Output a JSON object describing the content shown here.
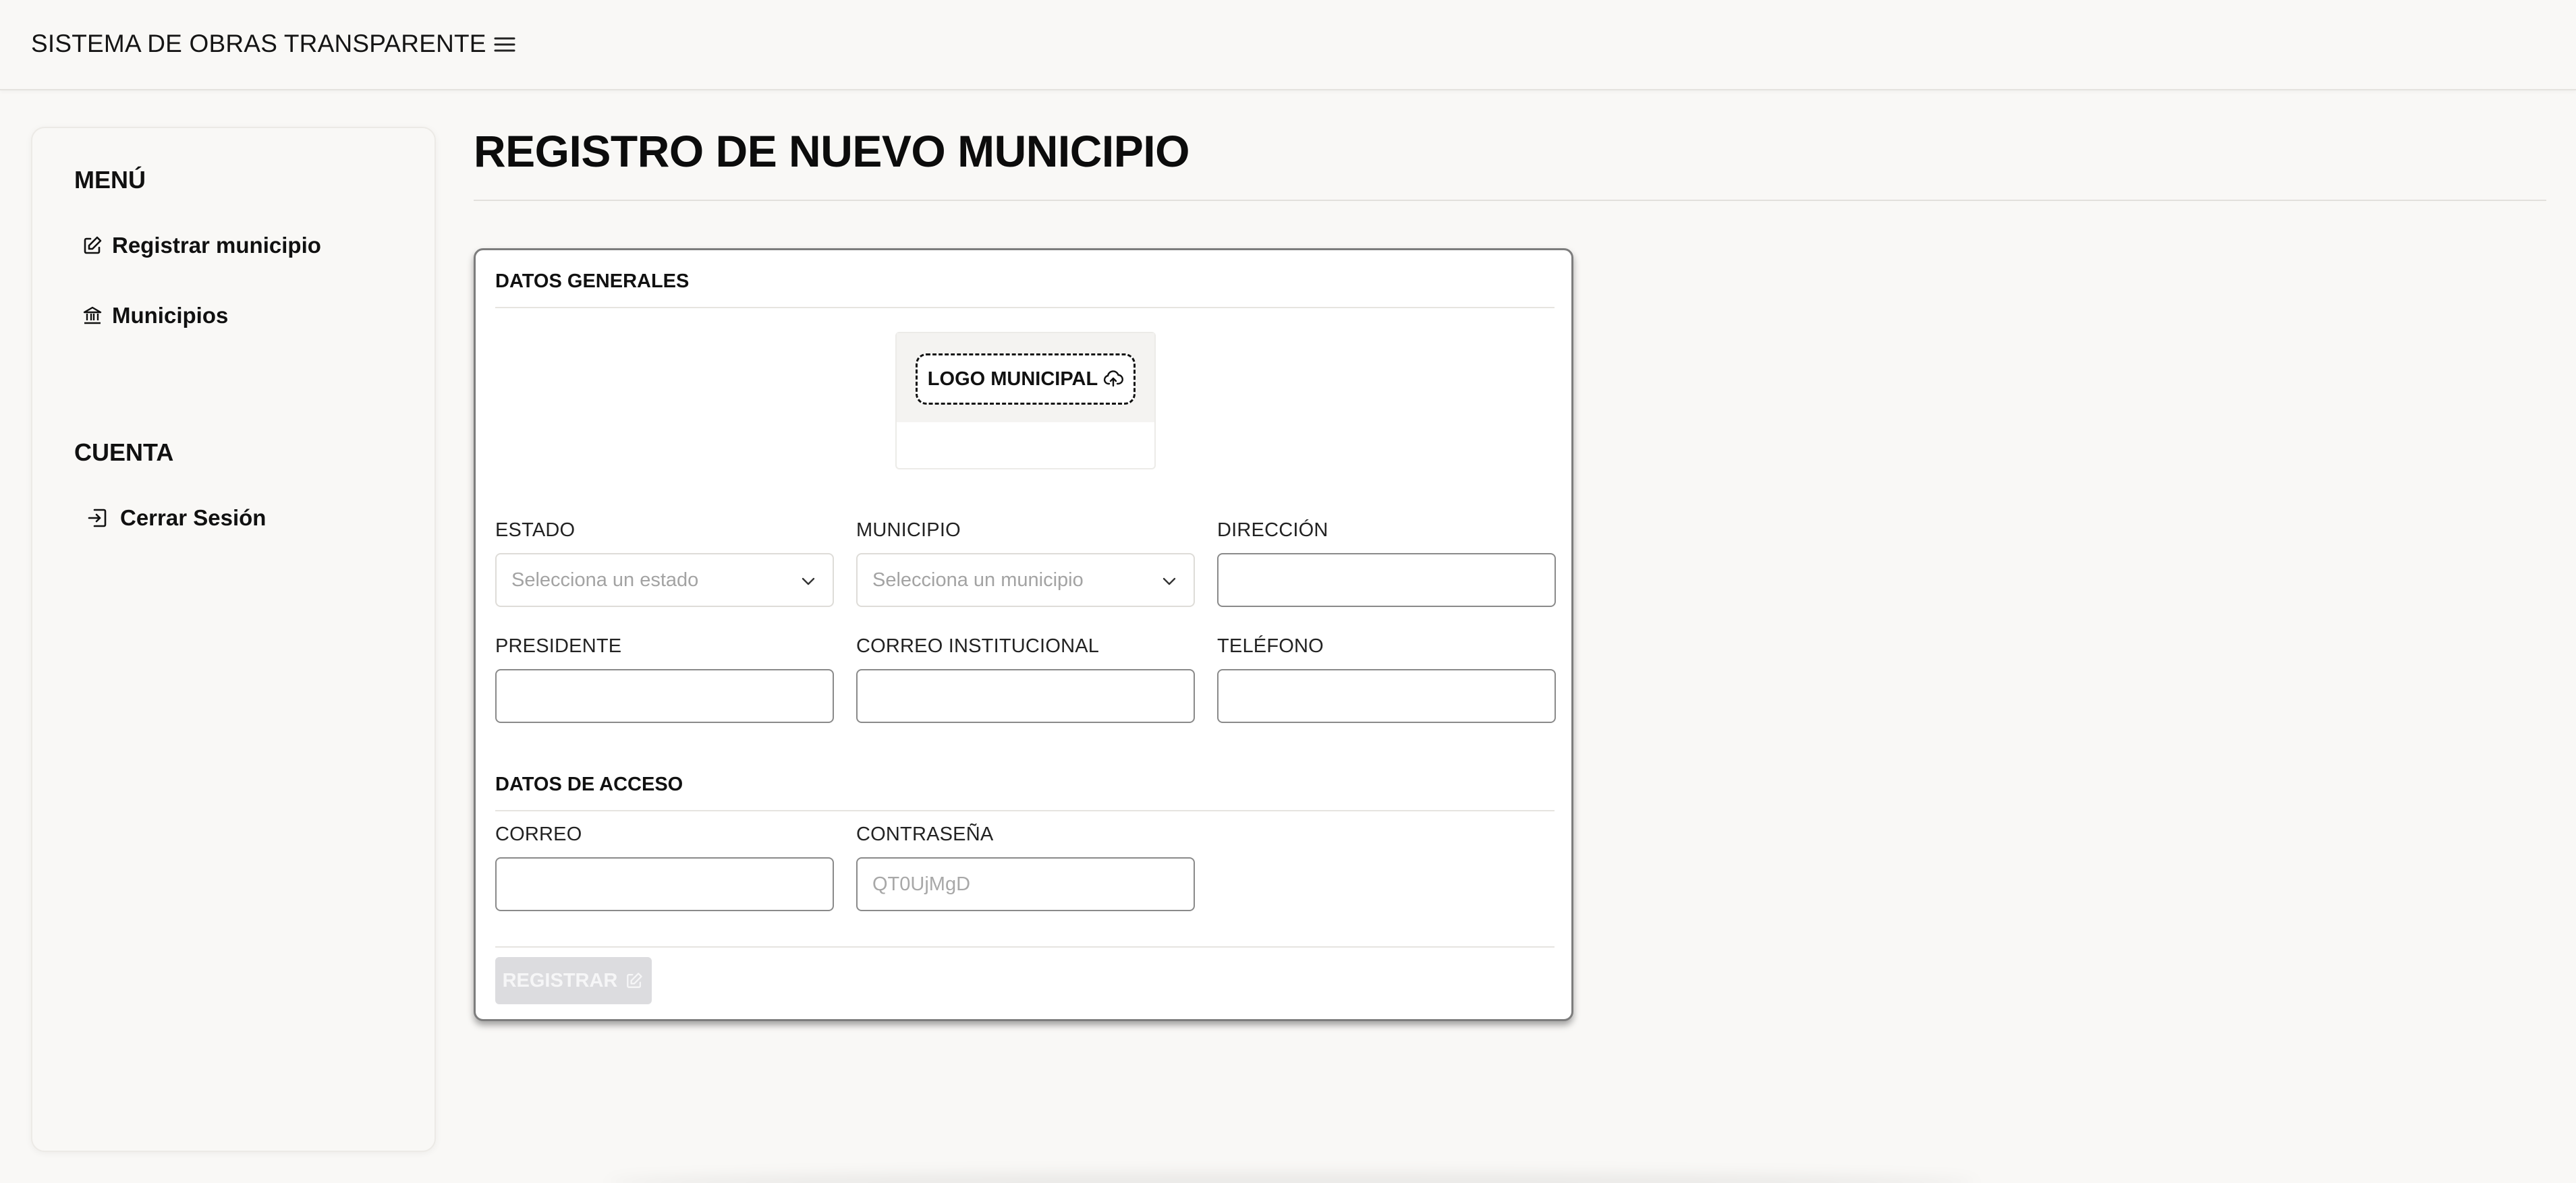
{
  "app": {
    "title": "SISTEMA DE OBRAS TRANSPARENTE"
  },
  "sidebar": {
    "menu_heading": "MENÚ",
    "items": [
      {
        "label": "Registrar municipio",
        "icon": "edit-icon"
      },
      {
        "label": "Municipios",
        "icon": "bank-icon"
      }
    ],
    "account_heading": "CUENTA",
    "account_items": [
      {
        "label": "Cerrar Sesión",
        "icon": "logout-icon"
      }
    ]
  },
  "main": {
    "title": "REGISTRO DE NUEVO MUNICIPIO",
    "general": {
      "title": "DATOS GENERALES",
      "logo_label": "LOGO MUNICIPAL",
      "estado": {
        "label": "ESTADO",
        "placeholder": "Selecciona un estado"
      },
      "municipio": {
        "label": "MUNICIPIO",
        "placeholder": "Selecciona un municipio"
      },
      "direccion": {
        "label": "DIRECCIÓN",
        "value": ""
      },
      "presidente": {
        "label": "PRESIDENTE",
        "value": ""
      },
      "correo_institucional": {
        "label": "CORREO INSTITUCIONAL",
        "value": ""
      },
      "telefono": {
        "label": "TELÉFONO",
        "value": ""
      }
    },
    "access": {
      "title": "DATOS DE ACCESO",
      "correo": {
        "label": "CORREO",
        "value": ""
      },
      "contrasena": {
        "label": "CONTRASEÑA",
        "placeholder": "QT0UjMgD"
      }
    },
    "submit": {
      "label": "REGISTRAR",
      "enabled": false
    }
  },
  "colors": {
    "background": "#f9f8f6",
    "card_border": "#7d7d7d",
    "button_disabled": "#dcdcdf"
  }
}
